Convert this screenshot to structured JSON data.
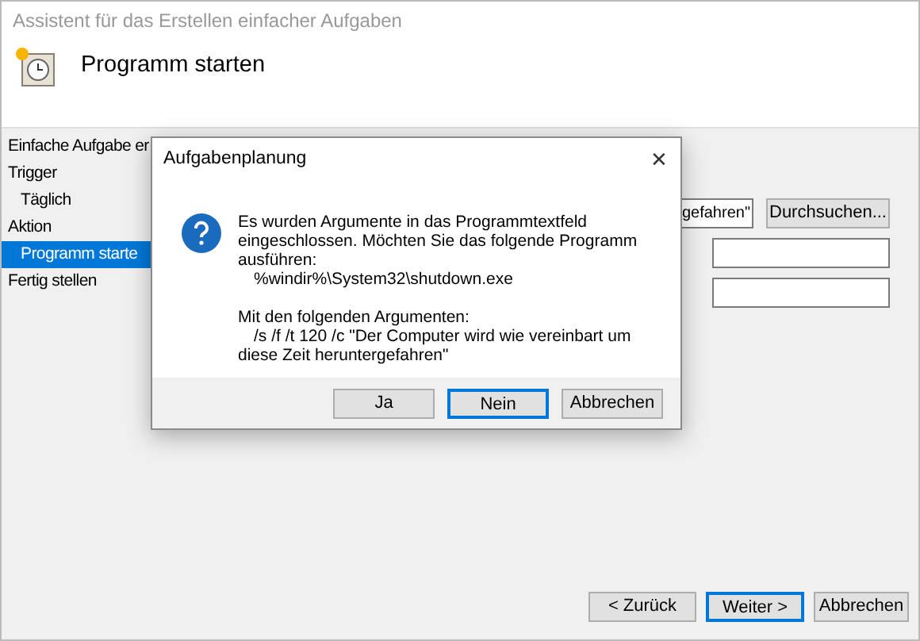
{
  "window": {
    "title": "Assistent für das Erstellen einfacher Aufgaben"
  },
  "header": {
    "title": "Programm starten"
  },
  "nav": [
    {
      "label": "Einfache Aufgabe er",
      "selected": false
    },
    {
      "label": "Trigger",
      "selected": false,
      "children": [
        {
          "label": "Täglich",
          "selected": false
        }
      ]
    },
    {
      "label": "Aktion",
      "selected": false,
      "children": [
        {
          "label": "Programm starte",
          "selected": true
        }
      ]
    },
    {
      "label": "Fertig stellen",
      "selected": false
    }
  ],
  "program_field": {
    "value": "gefahren\""
  },
  "browse_button": "Durchsuchen...",
  "footer_buttons": [
    {
      "label": "< Zurück",
      "focused": false
    },
    {
      "label": "Weiter >",
      "focused": true
    },
    {
      "label": "Abbrechen",
      "focused": false
    }
  ],
  "dialog": {
    "title": "Aufgabenplanung",
    "close": "✕",
    "paragraphs": [
      {
        "lines": [
          {
            "text": "Es wurden Argumente in das Programmtextfeld eingeschlossen. Möchten Sie das folgende Programm ausführen:",
            "indent": false
          },
          {
            "text": "%windir%\\System32\\shutdown.exe",
            "indent": true
          }
        ]
      },
      {
        "lines": [
          {
            "text": "Mit den folgenden Argumenten:",
            "indent": false
          },
          {
            "text": "/s /f /t 120 /c \"Der Computer wird wie vereinbart um diese Zeit heruntergefahren\"",
            "indent": true
          }
        ]
      }
    ],
    "buttons": [
      {
        "label": "Ja",
        "focused": false
      },
      {
        "label": "Nein",
        "focused": true
      },
      {
        "label": "Abbrechen",
        "focused": false
      }
    ]
  }
}
